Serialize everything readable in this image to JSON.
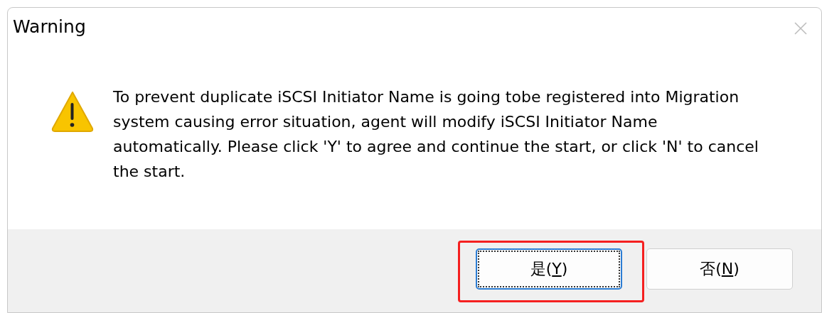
{
  "window": {
    "title": "Warning",
    "close_disabled": true
  },
  "message": "To prevent duplicate iSCSI Initiator Name is going tobe registered into Migration system causing error situation, agent will modify iSCSI Initiator Name automatically. Please click 'Y' to agree and continue the start, or click 'N' to cancel the start.",
  "buttons": [
    {
      "label_before": "是(",
      "mnemonic": "Y",
      "label_after": ")",
      "focused": true,
      "highlighted": true
    },
    {
      "label_before": "否(",
      "mnemonic": "N",
      "label_after": ")",
      "focused": false,
      "highlighted": false
    }
  ]
}
